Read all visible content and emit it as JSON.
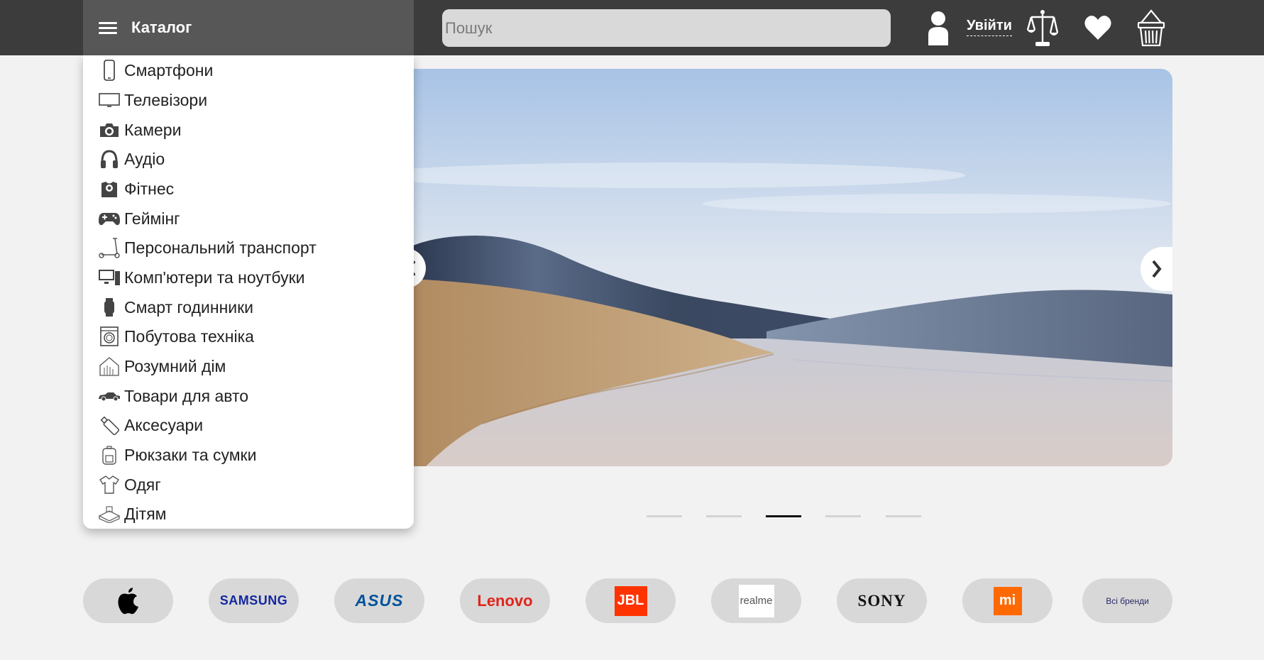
{
  "header": {
    "catalog_label": "Каталог",
    "search_placeholder": "Пошук",
    "login_label": "Увійти"
  },
  "catalog": {
    "items": [
      {
        "label": "Смартфони",
        "icon": "smartphone-icon"
      },
      {
        "label": "Телевізори",
        "icon": "tv-icon"
      },
      {
        "label": "Камери",
        "icon": "camera-icon"
      },
      {
        "label": "Аудіо",
        "icon": "headphones-icon"
      },
      {
        "label": "Фітнес",
        "icon": "fitness-icon"
      },
      {
        "label": "Геймінг",
        "icon": "gamepad-icon"
      },
      {
        "label": "Персональний транспорт",
        "icon": "scooter-icon"
      },
      {
        "label": "Комп'ютери та ноутбуки",
        "icon": "computer-icon"
      },
      {
        "label": "Смарт годинники",
        "icon": "smartwatch-icon"
      },
      {
        "label": "Побутова техніка",
        "icon": "washing-machine-icon"
      },
      {
        "label": "Розумний дім",
        "icon": "smart-home-icon"
      },
      {
        "label": "Товари для авто",
        "icon": "car-icon"
      },
      {
        "label": "Аксесуари",
        "icon": "usb-stick-icon"
      },
      {
        "label": "Рюкзаки та сумки",
        "icon": "backpack-icon"
      },
      {
        "label": "Одяг",
        "icon": "shirt-icon"
      },
      {
        "label": "Дітям",
        "icon": "toy-icon"
      }
    ]
  },
  "slider": {
    "slide_count": 5,
    "active_index": 2
  },
  "brands": {
    "items": [
      {
        "name": "apple",
        "label": ""
      },
      {
        "name": "samsung",
        "label": "SAMSUNG"
      },
      {
        "name": "asus",
        "label": "ASUS"
      },
      {
        "name": "lenovo",
        "label": "Lenovo"
      },
      {
        "name": "jbl",
        "label": "JBL"
      },
      {
        "name": "realme",
        "label": "realme"
      },
      {
        "name": "sony",
        "label": "SONY"
      },
      {
        "name": "xiaomi",
        "label": "mi"
      },
      {
        "name": "all-brands",
        "label": "Всі бренди"
      }
    ]
  },
  "colors": {
    "header_bg": "#3c3c3c",
    "catalog_bg": "#575757",
    "page_bg": "#f2f2f2",
    "samsung_blue": "#1428a0",
    "asus_blue": "#00539b",
    "lenovo_red": "#e2231a",
    "jbl_orange": "#ff3300",
    "xiaomi_orange": "#ff6900"
  }
}
